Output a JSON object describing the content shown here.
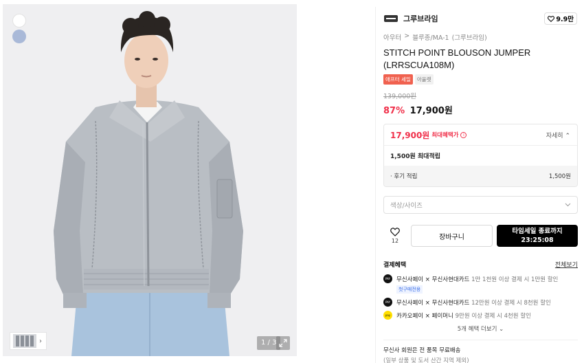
{
  "gallery": {
    "page_counter": "1 / 3",
    "color_swatches": [
      "#ffffff",
      "#a9b9d8"
    ]
  },
  "brand": {
    "name": "그루브라임",
    "like_count": "9.9만"
  },
  "breadcrumb": [
    "아우터",
    "블루종/MA-1",
    "(그루브라임)"
  ],
  "product": {
    "title": "STITCH POINT BLOUSON JUMPER (LRRSCUA108M)",
    "badges": [
      "애프터 세일",
      "아울렛"
    ],
    "original_price": "139,000원",
    "discount": "87%",
    "price": "17,900원"
  },
  "benefit": {
    "price": "17,900원",
    "label": "최대혜택가",
    "detail_toggle": "자세히",
    "points_title": "1,500원 최대적립",
    "sub_label": "· 후기 적립",
    "sub_value": "1,500원"
  },
  "option_select": {
    "placeholder": "색상/사이즈"
  },
  "actions": {
    "wish_count": "12",
    "cart_label": "장바구니",
    "buy_line1": "타임세일 종료까지",
    "buy_line2": "23:25:08"
  },
  "payment": {
    "heading": "결제혜택",
    "view_all": "전체보기",
    "items": [
      {
        "name": "무신사페이 × 무신사현대카드",
        "desc": "1만 1천원 이상 결제 시 1만원 할인",
        "tag": "첫구매전용"
      },
      {
        "name": "무신사페이 × 무신사현대카드",
        "desc": "12만원 이상 결제 시 8천원 할인",
        "tag": ""
      },
      {
        "name": "카카오페이 × 페이머니",
        "desc": "9만원 이상 결제 시 4천원 할인",
        "tag": ""
      }
    ],
    "more_link": "5개 혜택 더보기"
  },
  "shipping": {
    "title": "무신사 회원은 전 품목 무료배송",
    "sub": "(일부 상품 및 도서 산간 지역 제외)"
  },
  "colors": {
    "accent_red": "#f0304a",
    "sale_badge": "#f0614f",
    "card_tag_blue": "#3a6ee8"
  }
}
